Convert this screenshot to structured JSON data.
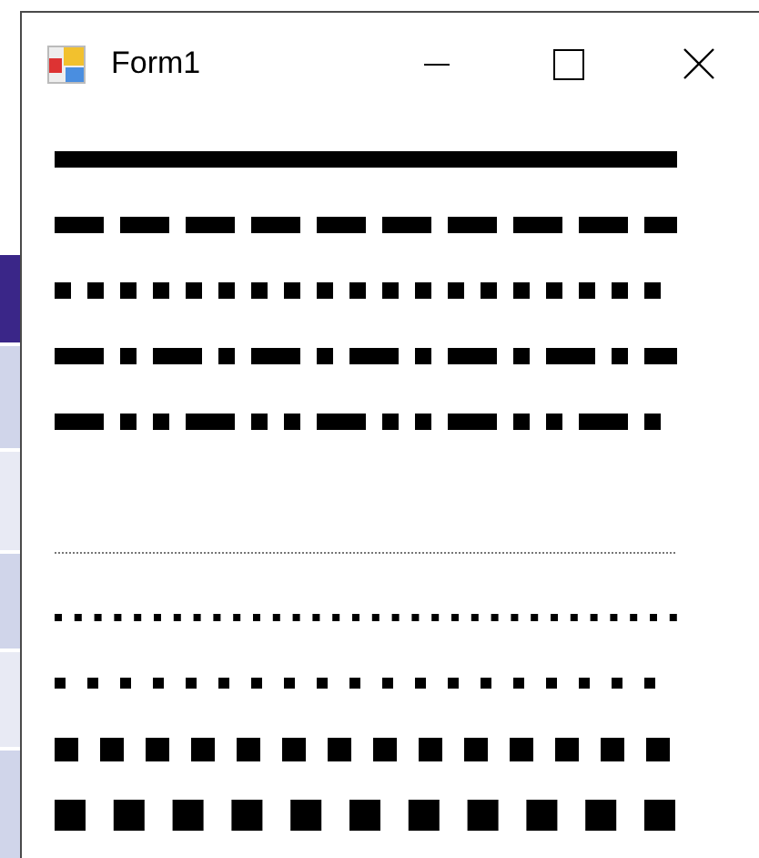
{
  "window": {
    "title": "Form1"
  },
  "line_groups": [
    {
      "lines": [
        {
          "kind": "solid"
        },
        {
          "kind": "dash"
        },
        {
          "kind": "dot"
        },
        {
          "kind": "dash-dot"
        },
        {
          "kind": "dash-dot-dot"
        }
      ]
    },
    {
      "lines": [
        {
          "kind": "hairline-dot"
        },
        {
          "kind": "small-square"
        },
        {
          "kind": "medium-square"
        },
        {
          "kind": "large-square"
        },
        {
          "kind": "xlarge-square"
        }
      ]
    }
  ]
}
